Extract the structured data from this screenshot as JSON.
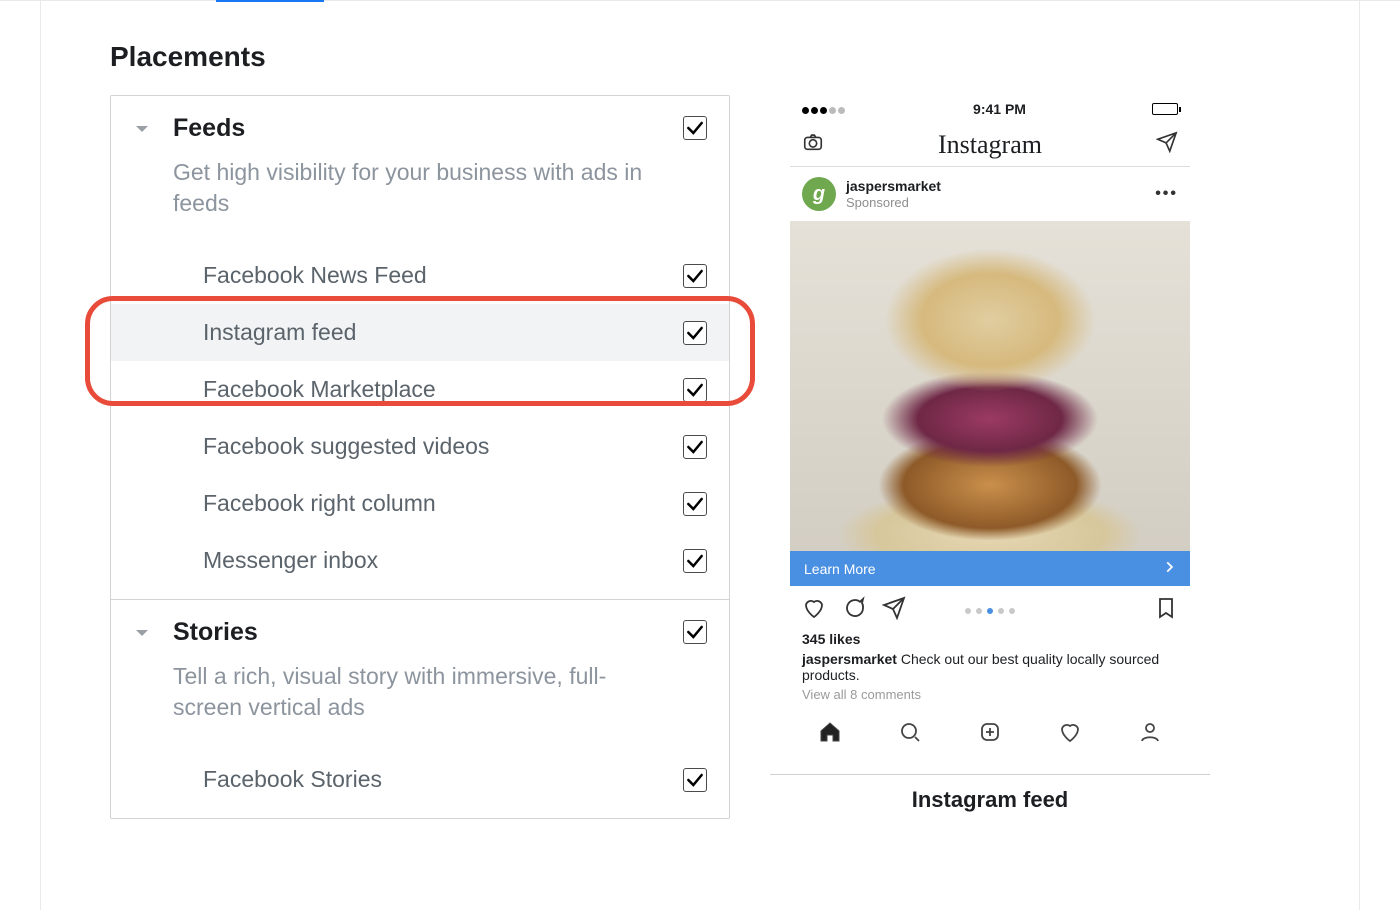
{
  "section_title": "Placements",
  "groups": [
    {
      "key": "feeds",
      "title": "Feeds",
      "description": "Get high visibility for your business with ads in feeds",
      "checked": true,
      "items": [
        {
          "key": "fb-news-feed",
          "label": "Facebook News Feed",
          "checked": true,
          "highlighted": false
        },
        {
          "key": "ig-feed",
          "label": "Instagram feed",
          "checked": true,
          "highlighted": true
        },
        {
          "key": "fb-marketplace",
          "label": "Facebook Marketplace",
          "checked": true,
          "highlighted": false
        },
        {
          "key": "fb-suggested-videos",
          "label": "Facebook suggested videos",
          "checked": true,
          "highlighted": false
        },
        {
          "key": "fb-right-column",
          "label": "Facebook right column",
          "checked": true,
          "highlighted": false
        },
        {
          "key": "messenger-inbox",
          "label": "Messenger inbox",
          "checked": true,
          "highlighted": false
        }
      ]
    },
    {
      "key": "stories",
      "title": "Stories",
      "description": "Tell a rich, visual story with immersive, full-screen vertical ads",
      "checked": true,
      "items": [
        {
          "key": "fb-stories",
          "label": "Facebook Stories",
          "checked": true,
          "highlighted": false
        }
      ]
    }
  ],
  "preview": {
    "platform_logo": "Instagram",
    "status_time": "9:41 PM",
    "account": "jaspersmarket",
    "sponsored_label": "Sponsored",
    "cta_label": "Learn More",
    "likes_text": "345 likes",
    "caption_user": "jaspersmarket",
    "caption_text": "Check out our best quality locally sourced products.",
    "view_all_text": "View all 8 comments",
    "preview_title": "Instagram feed"
  }
}
